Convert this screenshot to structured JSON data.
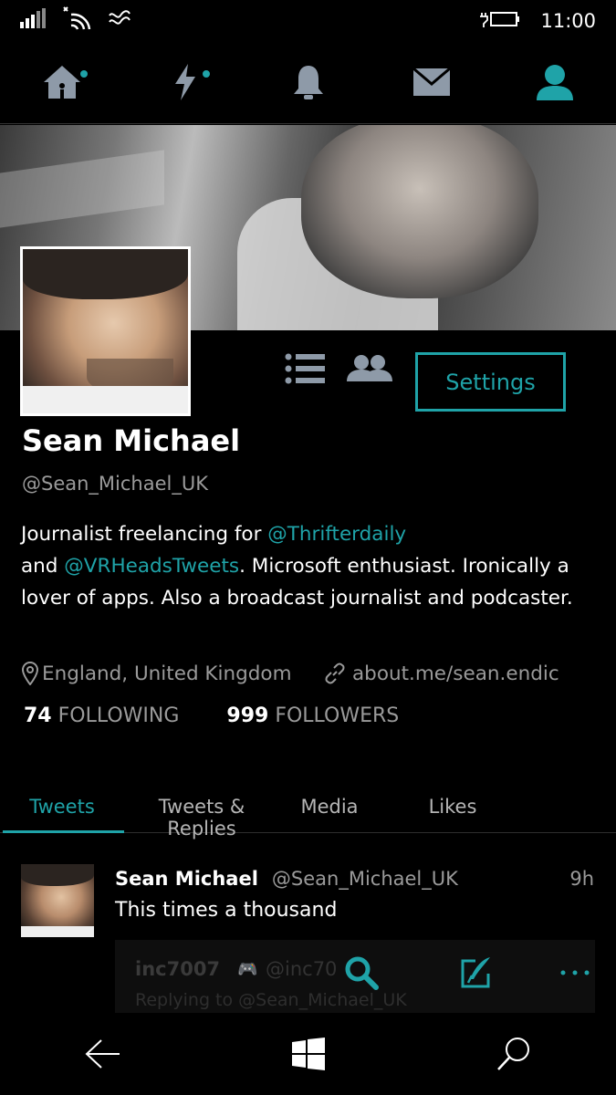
{
  "status_bar": {
    "time": "11:00",
    "icons": [
      "signal-icon",
      "wifi-icon",
      "data-icon",
      "battery-icon"
    ]
  },
  "top_nav": {
    "items": [
      {
        "name": "home-icon",
        "has_dot": true
      },
      {
        "name": "moments-icon",
        "has_dot": true
      },
      {
        "name": "notifications-icon",
        "has_dot": false
      },
      {
        "name": "messages-icon",
        "has_dot": false
      },
      {
        "name": "profile-icon",
        "has_dot": false,
        "active": true
      }
    ]
  },
  "profile": {
    "name": "Sean Michael",
    "handle": "@Sean_Michael_UK",
    "settings_label": "Settings",
    "bio": {
      "p1": "Journalist freelancing for ",
      "m1": "@Thrifterdaily",
      "p2": "and ",
      "m2": "@VRHeadsTweets",
      "p3": ". Microsoft enthusiast. Ironically a lover of apps. Also a broadcast journalist and podcaster."
    },
    "location": "England, United Kingdom",
    "url": "about.me/sean.endic",
    "following_count": "74",
    "following_label": "FOLLOWING",
    "followers_count": "999",
    "followers_label": "FOLLOWERS"
  },
  "tabs": [
    {
      "label": "Tweets",
      "active": true
    },
    {
      "label": "Tweets & Replies",
      "active": false
    },
    {
      "label": "Media",
      "active": false
    },
    {
      "label": "Likes",
      "active": false
    }
  ],
  "tweet": {
    "author": "Sean Michael",
    "handle": "@Sean_Michael_UK",
    "time": "9h",
    "text": "This times a thousand",
    "quoted": {
      "name": "inc7007",
      "handle": "@inc70",
      "reply_to": "Replying to @Sean_Michael_UK"
    }
  },
  "colors": {
    "accent": "#1fa3a8",
    "background": "#000000",
    "muted": "#9a9a9a"
  }
}
